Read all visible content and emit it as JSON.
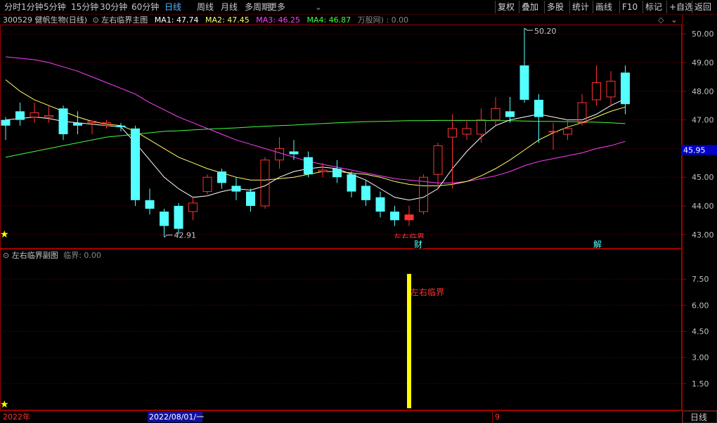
{
  "toolbar": {
    "periods": [
      "分时",
      "1分钟",
      "5分钟",
      "15分钟",
      "30分钟",
      "60分钟",
      "日线",
      "周线",
      "月线",
      "多周期",
      "更多"
    ],
    "active_period": "日线",
    "right_buttons": [
      "复权",
      "叠加",
      "多股",
      "统计",
      "画线",
      "F10",
      "标记",
      "+自选",
      "返回"
    ]
  },
  "main_panel": {
    "stock_label": "300529 健帆生物(日线)",
    "indicator_name": "左右临界主图",
    "ma": [
      {
        "label": "MA1: 47.74",
        "color": "#ffffff"
      },
      {
        "label": "MA2: 47.45",
        "color": "#ffff66"
      },
      {
        "label": "MA3: 46.25",
        "color": "#ff40ff"
      },
      {
        "label": "MA4: 46.87",
        "color": "#40ff40"
      }
    ],
    "extra": "万股网) : 0.00",
    "diamond": "◇",
    "high_label": "50.20",
    "low_label": "42.91",
    "marker_critical": "左右临界",
    "marker_cai": "财",
    "marker_jie": "解",
    "current_price": "45.95",
    "y_ticks": [
      "50.00",
      "49.00",
      "48.00",
      "47.00",
      "46.00",
      "45.00",
      "44.00",
      "43.00"
    ]
  },
  "sub_panel": {
    "title": "左右临界副图",
    "value_label": "临界: 0.00",
    "signal_label": "左右临界",
    "y_ticks": [
      "7.50",
      "6.00",
      "4.50",
      "3.00",
      "1.50"
    ]
  },
  "bottom_bar": {
    "year": "2022年",
    "date": "2022/08/01/一",
    "marker": "9",
    "period_tab": "日线"
  },
  "colors": {
    "up": "#ff3232",
    "down": "#54ffff",
    "grid": "#800000",
    "ma1": "#ffffff",
    "ma2": "#ffff66",
    "ma3": "#ff40ff",
    "ma4": "#40ff40",
    "signal": "#ffff00"
  },
  "chart_data": {
    "type": "candlestick",
    "candles": [
      [
        47.0,
        46.8,
        47.1,
        46.3
      ],
      [
        47.3,
        47.0,
        47.6,
        46.8
      ],
      [
        47.1,
        47.25,
        47.6,
        46.9
      ],
      [
        47.1,
        47.15,
        47.5,
        46.9
      ],
      [
        47.4,
        46.5,
        47.5,
        46.3
      ],
      [
        46.9,
        46.8,
        47.3,
        46.5
      ],
      [
        46.9,
        46.95,
        47.0,
        46.5
      ],
      [
        46.8,
        46.9,
        47.0,
        46.7
      ],
      [
        46.8,
        46.75,
        46.9,
        46.6
      ],
      [
        46.7,
        44.2,
        46.8,
        44.0
      ],
      [
        44.2,
        43.9,
        44.6,
        43.7
      ],
      [
        43.8,
        43.3,
        43.9,
        42.91
      ],
      [
        44.0,
        43.2,
        44.1,
        43.0
      ],
      [
        43.8,
        44.1,
        44.3,
        43.5
      ],
      [
        44.5,
        45.0,
        45.1,
        44.4
      ],
      [
        45.2,
        44.8,
        45.3,
        44.6
      ],
      [
        44.7,
        44.5,
        45.0,
        44.2
      ],
      [
        44.5,
        44.0,
        44.6,
        43.8
      ],
      [
        44.0,
        45.6,
        45.7,
        43.9
      ],
      [
        45.6,
        46.0,
        46.4,
        45.3
      ],
      [
        45.9,
        45.8,
        46.3,
        45.6
      ],
      [
        45.7,
        45.1,
        45.9,
        45.0
      ],
      [
        45.2,
        45.25,
        45.5,
        45.0
      ],
      [
        45.3,
        45.0,
        45.6,
        44.8
      ],
      [
        45.1,
        44.5,
        45.2,
        44.3
      ],
      [
        44.7,
        44.2,
        44.9,
        44.0
      ],
      [
        44.3,
        43.8,
        44.5,
        43.6
      ],
      [
        43.8,
        43.5,
        44.0,
        43.3
      ],
      [
        43.7,
        43.5,
        44.0,
        43.3
      ],
      [
        43.8,
        45.0,
        45.1,
        43.7
      ],
      [
        45.1,
        46.1,
        46.2,
        44.6
      ],
      [
        46.4,
        46.7,
        47.2,
        44.6
      ],
      [
        46.5,
        46.7,
        47.0,
        46.3
      ],
      [
        46.5,
        47.0,
        47.4,
        46.2
      ],
      [
        47.0,
        47.4,
        47.8,
        46.8
      ],
      [
        47.3,
        47.1,
        47.8,
        46.9
      ],
      [
        48.9,
        47.7,
        50.2,
        47.6
      ],
      [
        47.7,
        47.1,
        47.9,
        46.2
      ],
      [
        46.6,
        46.6,
        46.9,
        45.95
      ],
      [
        46.5,
        46.7,
        47.0,
        46.3
      ],
      [
        46.9,
        47.6,
        47.9,
        46.8
      ],
      [
        47.7,
        48.3,
        48.9,
        47.5
      ],
      [
        47.8,
        48.35,
        48.7,
        47.5
      ],
      [
        48.65,
        47.55,
        48.9,
        47.2
      ]
    ],
    "ma1": [
      47.0,
      47.05,
      47.1,
      47.05,
      46.95,
      46.9,
      46.85,
      46.8,
      46.75,
      46.2,
      45.6,
      45.0,
      44.6,
      44.3,
      44.35,
      44.5,
      44.6,
      44.55,
      44.7,
      45.0,
      45.2,
      45.3,
      45.35,
      45.3,
      45.1,
      44.9,
      44.6,
      44.3,
      44.2,
      44.3,
      44.6,
      45.3,
      45.9,
      46.4,
      46.8,
      47.0,
      47.1,
      47.2,
      47.1,
      47.0,
      47.0,
      47.2,
      47.5,
      47.74
    ],
    "ma2": [
      48.4,
      48.0,
      47.7,
      47.5,
      47.3,
      47.1,
      46.95,
      46.85,
      46.8,
      46.6,
      46.3,
      46.0,
      45.7,
      45.5,
      45.3,
      45.15,
      45.0,
      44.9,
      44.9,
      44.95,
      45.0,
      45.1,
      45.2,
      45.2,
      45.15,
      45.1,
      45.0,
      44.85,
      44.75,
      44.7,
      44.7,
      44.75,
      44.85,
      45.05,
      45.3,
      45.6,
      45.95,
      46.3,
      46.55,
      46.75,
      46.9,
      47.1,
      47.3,
      47.45
    ],
    "ma3": [
      49.2,
      49.15,
      49.1,
      49.0,
      48.85,
      48.7,
      48.5,
      48.3,
      48.1,
      47.9,
      47.6,
      47.35,
      47.1,
      46.9,
      46.7,
      46.5,
      46.3,
      46.15,
      46.0,
      45.85,
      45.7,
      45.55,
      45.45,
      45.35,
      45.25,
      45.15,
      45.05,
      44.95,
      44.9,
      44.85,
      44.8,
      44.8,
      44.85,
      44.95,
      45.05,
      45.2,
      45.4,
      45.55,
      45.65,
      45.75,
      45.85,
      46.0,
      46.1,
      46.25
    ],
    "ma4": [
      45.7,
      45.8,
      45.9,
      46.0,
      46.1,
      46.2,
      46.3,
      46.4,
      46.45,
      46.5,
      46.55,
      46.6,
      46.62,
      46.65,
      46.68,
      46.7,
      46.72,
      46.75,
      46.78,
      46.8,
      46.82,
      46.85,
      46.87,
      46.9,
      46.92,
      46.94,
      46.95,
      46.96,
      46.97,
      46.97,
      46.98,
      46.98,
      46.98,
      46.98,
      46.97,
      46.97,
      46.96,
      46.95,
      46.95,
      46.94,
      46.93,
      46.92,
      46.9,
      46.87
    ],
    "ylim": [
      42.75,
      50.3
    ],
    "signal_bar": {
      "index": 28,
      "value": 7.8
    },
    "sub_ylim": [
      0,
      8.6
    ]
  }
}
